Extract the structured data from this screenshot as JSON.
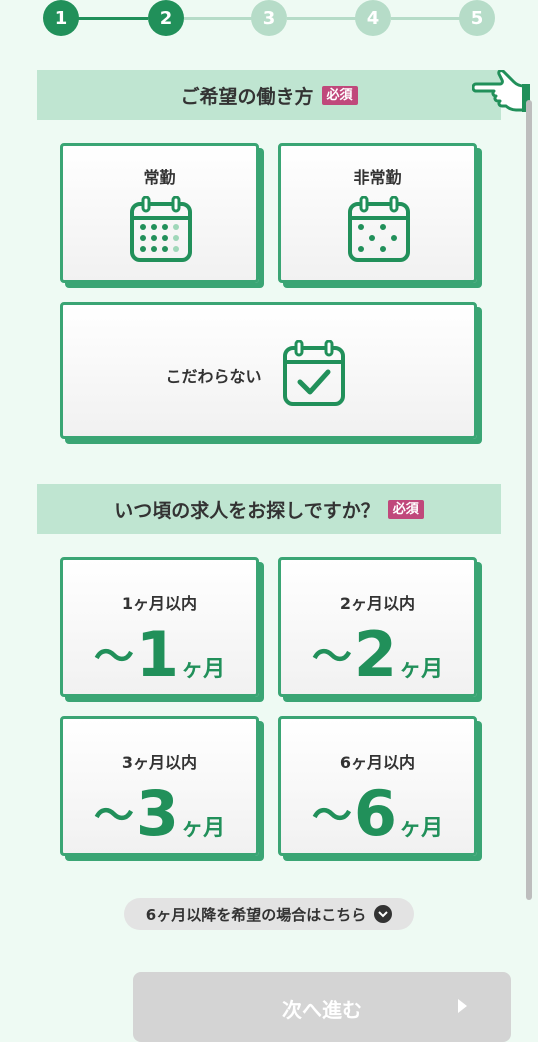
{
  "progress": {
    "steps": [
      {
        "label": "1",
        "state": "active"
      },
      {
        "label": "2",
        "state": "active"
      },
      {
        "label": "3",
        "state": "inactive"
      },
      {
        "label": "4",
        "state": "inactive"
      },
      {
        "label": "5",
        "state": "inactive"
      }
    ]
  },
  "work_style": {
    "title": "ご希望の働き方",
    "required": "必須",
    "options": [
      {
        "label": "常勤",
        "icon": "calendar-full-icon"
      },
      {
        "label": "非常勤",
        "icon": "calendar-partial-icon"
      },
      {
        "label": "こだわらない",
        "icon": "calendar-check-icon"
      }
    ]
  },
  "timing": {
    "title": "いつ頃の求人をお探しですか？",
    "required": "必須",
    "options": [
      {
        "label": "1ヶ月以内",
        "tilde": "～",
        "num": "1",
        "unit": "ヶ月"
      },
      {
        "label": "2ヶ月以内",
        "tilde": "～",
        "num": "2",
        "unit": "ヶ月"
      },
      {
        "label": "3ヶ月以内",
        "tilde": "～",
        "num": "3",
        "unit": "ヶ月"
      },
      {
        "label": "6ヶ月以内",
        "tilde": "～",
        "num": "6",
        "unit": "ヶ月"
      }
    ],
    "more_link": "6ヶ月以降を希望の場合はこちら"
  },
  "footer": {
    "next_label": "次へ進む"
  },
  "colors": {
    "accent": "#21905a",
    "card_border": "#3aa574",
    "header_bg": "#bfe5d1",
    "badge": "#c0487b",
    "page_bg": "#eefaf3"
  }
}
